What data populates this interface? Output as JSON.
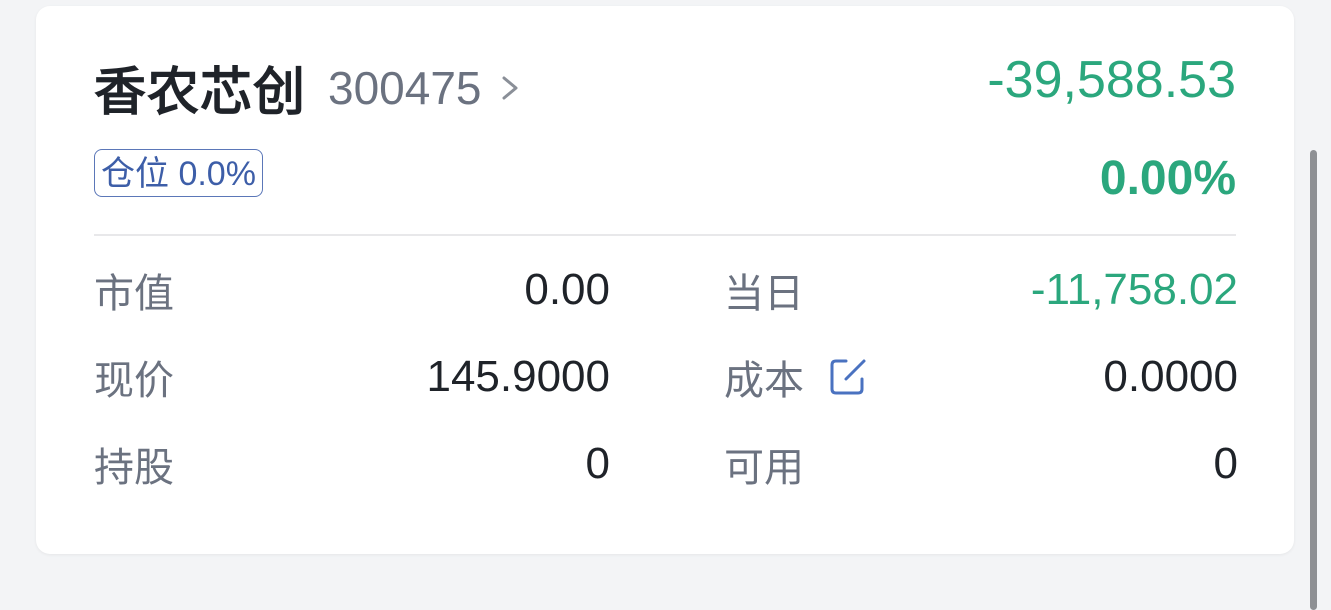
{
  "holding": {
    "name": "香农芯创",
    "code": "300475",
    "total_pnl": "-39,588.53",
    "pnl_ratio": "0.00%",
    "position_badge": "仓位 0.0%"
  },
  "stats": {
    "market_value_label": "市值",
    "market_value": "0.00",
    "daily_label": "当日",
    "daily_pnl": "-11,758.02",
    "price_label": "现价",
    "price": "145.9000",
    "cost_label": "成本",
    "cost": "0.0000",
    "shares_label": "持股",
    "shares": "0",
    "available_label": "可用",
    "available": "0"
  },
  "colors": {
    "positive_down": "#2ba77d",
    "badge_blue": "#3d5ea8",
    "text_primary": "#1f2329",
    "text_secondary": "#6b7280"
  },
  "icons": {
    "code_arrow": "chevron-right-icon",
    "cost_edit": "edit-icon"
  }
}
